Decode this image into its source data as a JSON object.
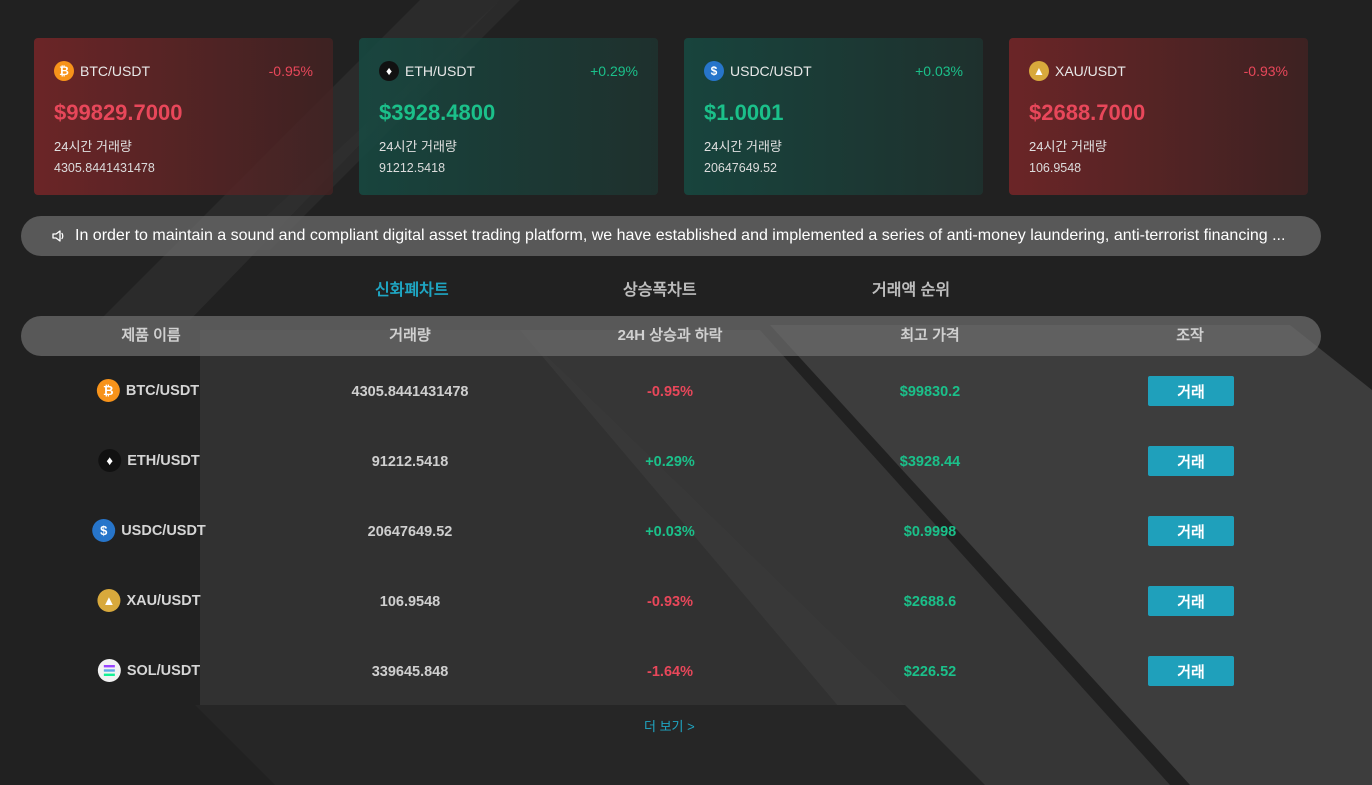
{
  "ticker_cards": [
    {
      "icon": "bitcoin-icon",
      "symbol": "BTC/USDT",
      "change": "-0.95%",
      "price": "$99829.7000",
      "volume_label": "24시간 거래량",
      "volume": "4305.8441431478",
      "trend": "down"
    },
    {
      "icon": "ethereum-icon",
      "symbol": "ETH/USDT",
      "change": "+0.29%",
      "price": "$3928.4800",
      "volume_label": "24시간 거래량",
      "volume": "91212.5418",
      "trend": "up"
    },
    {
      "icon": "usdc-icon",
      "symbol": "USDC/USDT",
      "change": "+0.03%",
      "price": "$1.0001",
      "volume_label": "24시간 거래량",
      "volume": "20647649.52",
      "trend": "up"
    },
    {
      "icon": "gold-icon",
      "symbol": "XAU/USDT",
      "change": "-0.93%",
      "price": "$2688.7000",
      "volume_label": "24시간 거래량",
      "volume": "106.9548",
      "trend": "down"
    }
  ],
  "notice": {
    "icon": "speaker-icon",
    "text": "In order to maintain a sound and compliant digital asset trading platform, we have established and implemented a series of anti-money laundering, anti-terrorist financing ..."
  },
  "tabs": [
    {
      "label": "신화폐차트",
      "active": true
    },
    {
      "label": "상승폭차트",
      "active": false
    },
    {
      "label": "거래액 순위",
      "active": false
    }
  ],
  "table": {
    "headers": [
      "제품 이름",
      "거래량",
      "24H 상승과 하락",
      "최고 가격",
      "조작"
    ],
    "rows": [
      {
        "icon": "bitcoin-icon",
        "pair": "BTC/USDT",
        "volume": "4305.8441431478",
        "change": "-0.95%",
        "high": "$99830.2",
        "action": "거래",
        "trend": "down"
      },
      {
        "icon": "ethereum-icon",
        "pair": "ETH/USDT",
        "volume": "91212.5418",
        "change": "+0.29%",
        "high": "$3928.44",
        "action": "거래",
        "trend": "up"
      },
      {
        "icon": "usdc-icon",
        "pair": "USDC/USDT",
        "volume": "20647649.52",
        "change": "+0.03%",
        "high": "$0.9998",
        "action": "거래",
        "trend": "up"
      },
      {
        "icon": "gold-icon",
        "pair": "XAU/USDT",
        "volume": "106.9548",
        "change": "-0.93%",
        "high": "$2688.6",
        "action": "거래",
        "trend": "down"
      },
      {
        "icon": "solana-icon",
        "pair": "SOL/USDT",
        "volume": "339645.848",
        "change": "-1.64%",
        "high": "$226.52",
        "action": "거래",
        "trend": "down"
      }
    ]
  },
  "more_link": "더 보기 >",
  "colors": {
    "up": "#1bc08a",
    "down": "#e8475a",
    "accent": "#1fa6c3",
    "button": "#1fa0bb"
  }
}
